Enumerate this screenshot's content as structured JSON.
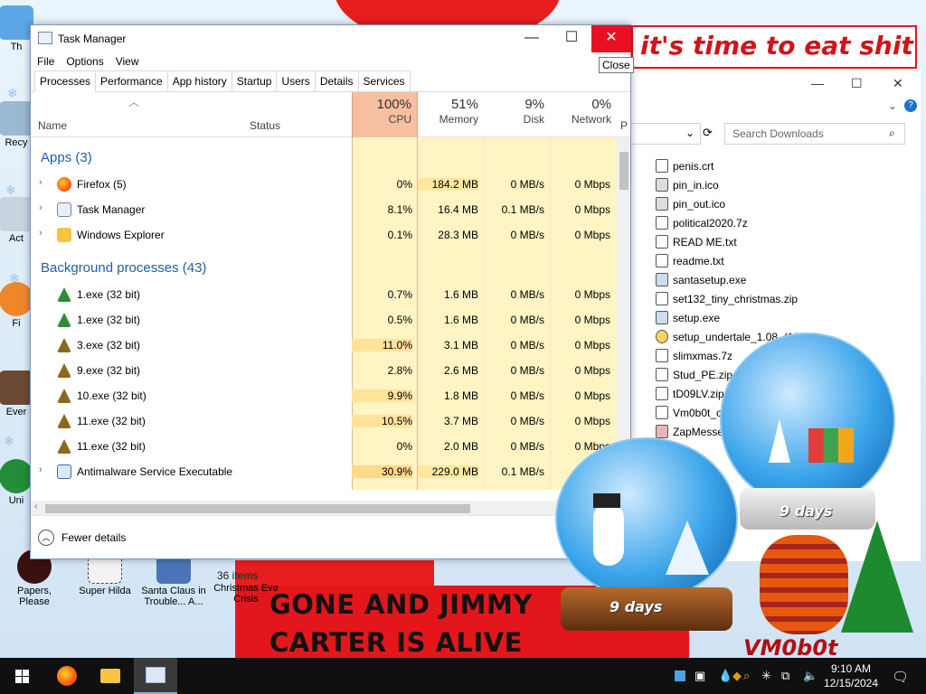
{
  "desktop": {
    "icons": [
      {
        "label": "Papers, Please"
      },
      {
        "label": "Super Hilda"
      },
      {
        "label": "Santa Claus in Trouble... A..."
      },
      {
        "label": "Christmas Eve Crisis"
      }
    ],
    "edge_labels": [
      "Th",
      "Recy",
      "Act",
      "Fi",
      "Ever",
      "Uni"
    ],
    "banner_line1": "GONE AND JIMMY",
    "banner_line2": "CARTER IS ALIVE",
    "top_banner": "it's time to eat shit",
    "signature": "VM0b0t",
    "globe_small_text": "9 days",
    "globe_large_text": "9 days"
  },
  "explorer": {
    "search_placeholder": "Search Downloads",
    "items_count": "36 items",
    "files": [
      "penis.crt",
      "pin_in.ico",
      "pin_out.ico",
      "political2020.7z",
      "READ ME.txt",
      "readme.txt",
      "santasetup.exe",
      "set132_tiny_christmas.zip",
      "setup.exe",
      "setup_undertale_1.08_(100",
      "slimxmas.7z",
      "Stud_PE.zip",
      "tD09LV.zip",
      "Vm0b0t_c",
      "ZapMesse"
    ]
  },
  "taskmanager": {
    "title": "Task Manager",
    "tooltip": "Close",
    "menu": [
      "File",
      "Options",
      "View"
    ],
    "tabs": [
      "Processes",
      "Performance",
      "App history",
      "Startup",
      "Users",
      "Details",
      "Services"
    ],
    "columns": {
      "name": "Name",
      "status": "Status",
      "cpu_pct": "100%",
      "cpu": "CPU",
      "mem_pct": "51%",
      "mem": "Memory",
      "disk_pct": "9%",
      "disk": "Disk",
      "net_pct": "0%",
      "net": "Network",
      "extra": "P"
    },
    "group_apps": "Apps (3)",
    "group_bg": "Background processes (43)",
    "apps": [
      {
        "name": "Firefox (5)",
        "cpu": "0%",
        "mem": "184.2 MB",
        "disk": "0 MB/s",
        "net": "0 Mbps"
      },
      {
        "name": "Task Manager",
        "cpu": "8.1%",
        "mem": "16.4 MB",
        "disk": "0.1 MB/s",
        "net": "0 Mbps"
      },
      {
        "name": "Windows Explorer",
        "cpu": "0.1%",
        "mem": "28.3 MB",
        "disk": "0 MB/s",
        "net": "0 Mbps"
      }
    ],
    "bg": [
      {
        "name": "1.exe (32 bit)",
        "cpu": "0.7%",
        "mem": "1.6 MB",
        "disk": "0 MB/s",
        "net": "0 Mbps"
      },
      {
        "name": "1.exe (32 bit)",
        "cpu": "0.5%",
        "mem": "1.6 MB",
        "disk": "0 MB/s",
        "net": "0 Mbps"
      },
      {
        "name": "3.exe (32 bit)",
        "cpu": "11.0%",
        "mem": "3.1 MB",
        "disk": "0 MB/s",
        "net": "0 Mbps"
      },
      {
        "name": "9.exe (32 bit)",
        "cpu": "2.8%",
        "mem": "2.6 MB",
        "disk": "0 MB/s",
        "net": "0 Mbps"
      },
      {
        "name": "10.exe (32 bit)",
        "cpu": "9.9%",
        "mem": "1.8 MB",
        "disk": "0 MB/s",
        "net": "0 Mbps"
      },
      {
        "name": "11.exe (32 bit)",
        "cpu": "10.5%",
        "mem": "3.7 MB",
        "disk": "0 MB/s",
        "net": "0 Mbps"
      },
      {
        "name": "11.exe (32 bit)",
        "cpu": "0%",
        "mem": "2.0 MB",
        "disk": "0 MB/s",
        "net": "0 Mbps"
      },
      {
        "name": "Antimalware Service Executable",
        "cpu": "30.9%",
        "mem": "229.0 MB",
        "disk": "0.1 MB/s",
        "net": "0 Mbps"
      }
    ],
    "fewer_details": "Fewer details"
  },
  "taskbar": {
    "time": "9:10 AM",
    "date": "12/15/2024"
  },
  "colors": {
    "cpu_header": "#f7bfa1",
    "heat_light": "#fff4c4",
    "heat_mid": "#ffe7a0",
    "heat_strong": "#ffd98a",
    "group": "#1f5ea8"
  }
}
